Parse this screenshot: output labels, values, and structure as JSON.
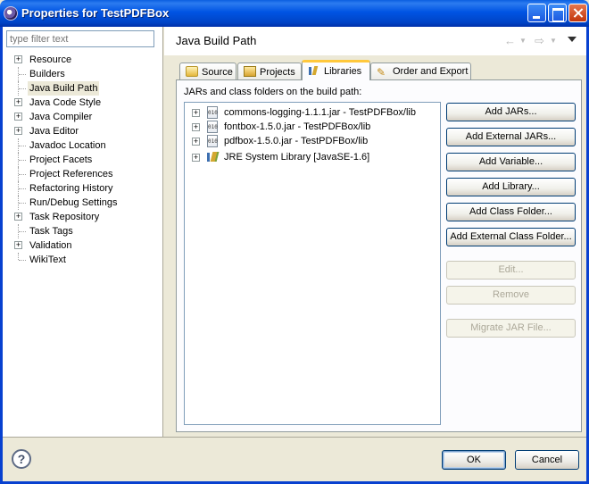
{
  "window": {
    "title": "Properties for TestPDFBox"
  },
  "left_panel": {
    "filter_placeholder": "type filter text",
    "items": [
      {
        "label": "Resource",
        "expandable": true
      },
      {
        "label": "Builders",
        "expandable": false
      },
      {
        "label": "Java Build Path",
        "expandable": false,
        "selected": true
      },
      {
        "label": "Java Code Style",
        "expandable": true
      },
      {
        "label": "Java Compiler",
        "expandable": true
      },
      {
        "label": "Java Editor",
        "expandable": true
      },
      {
        "label": "Javadoc Location",
        "expandable": false
      },
      {
        "label": "Project Facets",
        "expandable": false
      },
      {
        "label": "Project References",
        "expandable": false
      },
      {
        "label": "Refactoring History",
        "expandable": false
      },
      {
        "label": "Run/Debug Settings",
        "expandable": false
      },
      {
        "label": "Task Repository",
        "expandable": true
      },
      {
        "label": "Task Tags",
        "expandable": false
      },
      {
        "label": "Validation",
        "expandable": true
      },
      {
        "label": "WikiText",
        "expandable": false
      }
    ]
  },
  "header": {
    "title": "Java Build Path",
    "back_icon": "←",
    "forward_icon": "⇨"
  },
  "tabs": [
    {
      "label": "Source",
      "icon": "source-icon"
    },
    {
      "label": "Projects",
      "icon": "projects-icon"
    },
    {
      "label": "Libraries",
      "icon": "libraries-icon",
      "active": true
    },
    {
      "label": "Order and Export",
      "icon": "order-export-icon"
    }
  ],
  "libraries": {
    "label": "JARs and class folders on the build path:",
    "jar_icon_text": "010",
    "entries": [
      {
        "text": "commons-logging-1.1.1.jar - TestPDFBox/lib",
        "icon": "jar-icon"
      },
      {
        "text": "fontbox-1.5.0.jar - TestPDFBox/lib",
        "icon": "jar-icon"
      },
      {
        "text": "pdfbox-1.5.0.jar - TestPDFBox/lib",
        "icon": "jar-icon"
      },
      {
        "text": "JRE System Library [JavaSE-1.6]",
        "icon": "library-icon"
      }
    ],
    "buttons": [
      {
        "label": "Add JARs...",
        "enabled": true
      },
      {
        "label": "Add External JARs...",
        "enabled": true
      },
      {
        "label": "Add Variable...",
        "enabled": true
      },
      {
        "label": "Add Library...",
        "enabled": true
      },
      {
        "label": "Add Class Folder...",
        "enabled": true
      },
      {
        "label": "Add External Class Folder...",
        "enabled": true
      },
      {
        "label": "Edit...",
        "enabled": false
      },
      {
        "label": "Remove",
        "enabled": false
      },
      {
        "label": "Migrate JAR File...",
        "enabled": false
      }
    ]
  },
  "footer": {
    "help_icon": "?",
    "ok_label": "OK",
    "cancel_label": "Cancel"
  }
}
